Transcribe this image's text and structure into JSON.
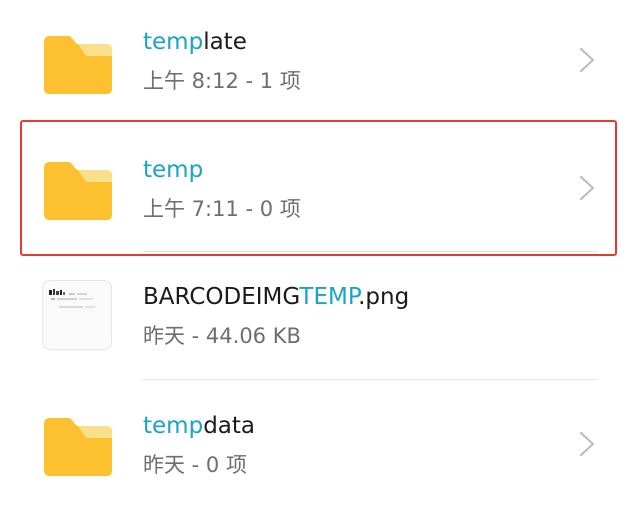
{
  "items": [
    {
      "name_highlight": "temp",
      "name_rest": "late",
      "meta": "上午 8:12 - 1 项",
      "type": "folder"
    },
    {
      "name_highlight": "temp",
      "name_rest": "",
      "meta": "上午 7:11 - 0 项",
      "type": "folder",
      "selected": true
    },
    {
      "name_prefix": "BARCODEIMG",
      "name_highlight": "TEMP",
      "name_suffix": ".png",
      "meta": "昨天 - 44.06 KB",
      "type": "image"
    },
    {
      "name_highlight": "temp",
      "name_rest": "data",
      "meta": "昨天 - 0 项",
      "type": "folder"
    }
  ],
  "colors": {
    "folder": "#FDC02F",
    "folder_tab": "#FBE08C",
    "highlight": "#1AA3C9",
    "selection_border": "#E53B35",
    "chevron": "#BDBDBD"
  },
  "icons": {
    "folder": "folder-icon",
    "image": "image-thumbnail",
    "chevron": "chevron-right-icon"
  }
}
